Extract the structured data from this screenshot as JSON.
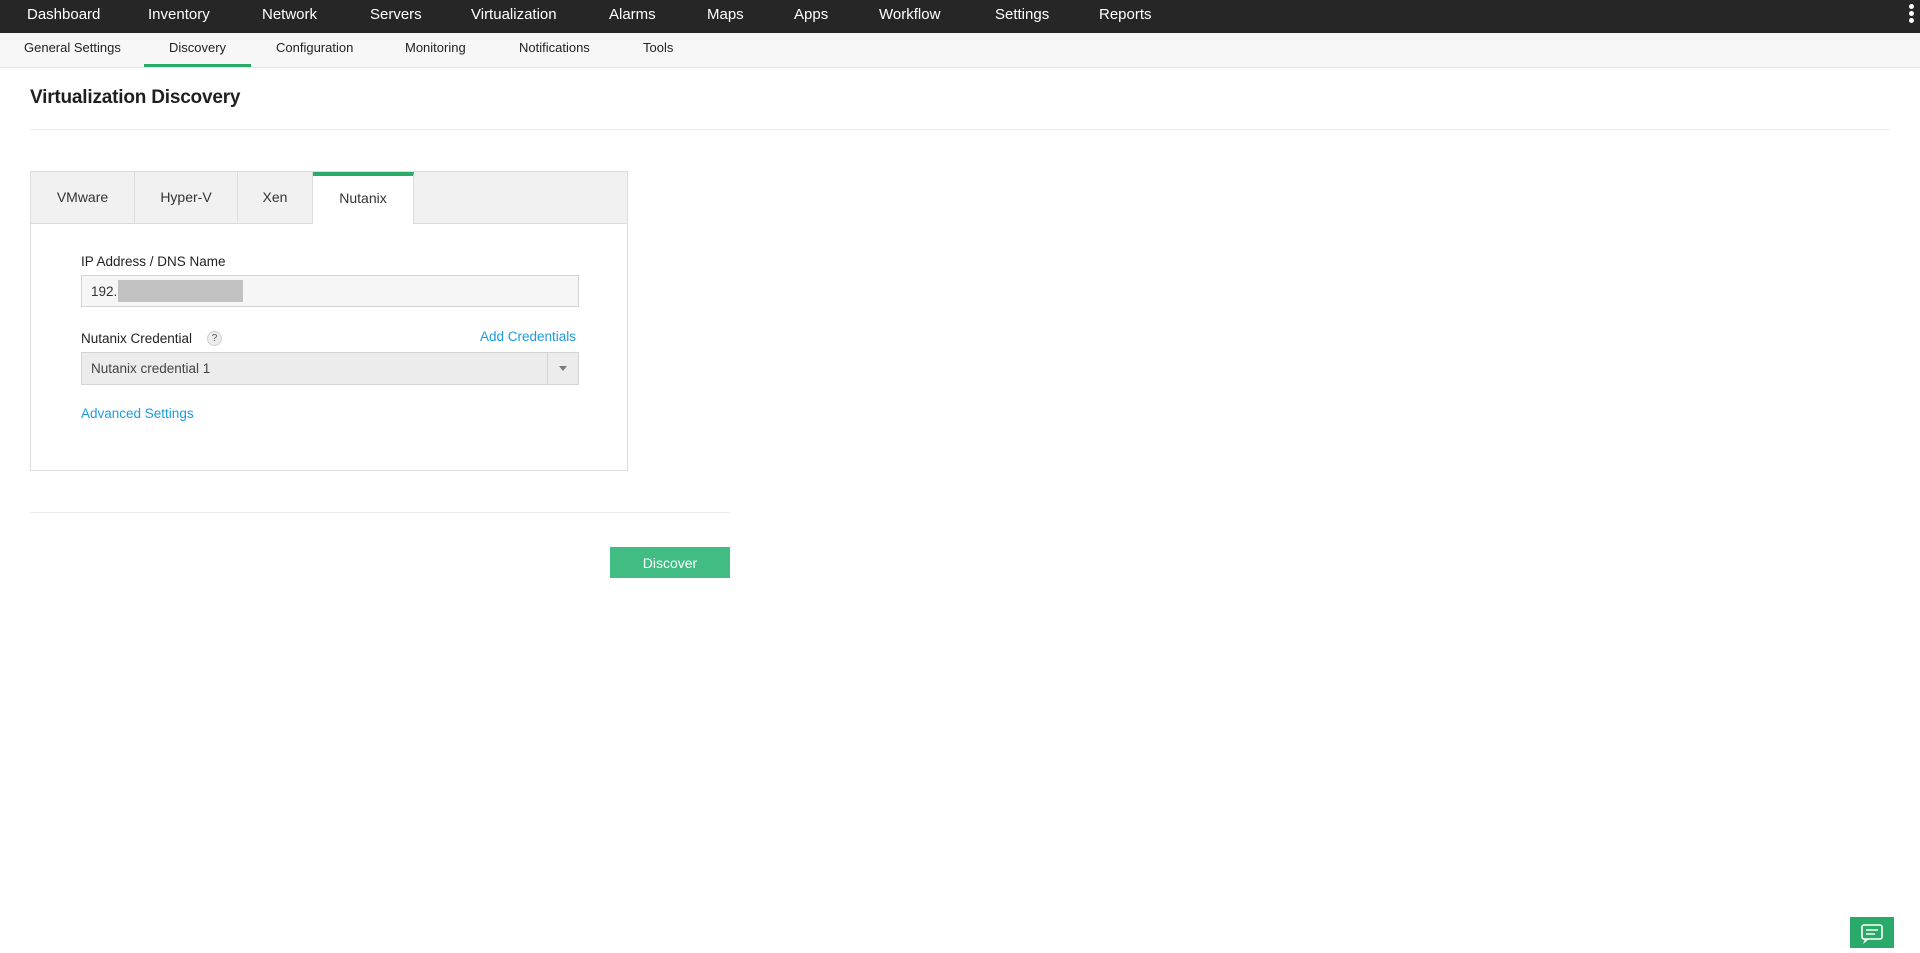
{
  "topnav": {
    "items": [
      "Dashboard",
      "Inventory",
      "Network",
      "Servers",
      "Virtualization",
      "Alarms",
      "Maps",
      "Apps",
      "Workflow",
      "Settings",
      "Reports"
    ],
    "more_icon": "vertical-ellipsis-icon"
  },
  "subnav": {
    "items": [
      "General Settings",
      "Discovery",
      "Configuration",
      "Monitoring",
      "Notifications",
      "Tools"
    ],
    "active": "Discovery"
  },
  "page": {
    "title": "Virtualization Discovery"
  },
  "tabs": {
    "items": [
      "VMware",
      "Hyper-V",
      "Xen",
      "Nutanix"
    ],
    "active": "Nutanix"
  },
  "form": {
    "ip_label": "IP Address / DNS Name",
    "ip_value": "192.",
    "credential_label": "Nutanix Credential",
    "help_icon": "question-mark-icon",
    "add_credentials": "Add Credentials",
    "credential_selected": "Nutanix credential 1",
    "advanced_settings": "Advanced Settings"
  },
  "actions": {
    "discover": "Discover"
  },
  "colors": {
    "topnav_bg": "#262626",
    "accent_green": "#2aaa68",
    "button_green": "#41bd83",
    "link_blue": "#1a9be0"
  }
}
